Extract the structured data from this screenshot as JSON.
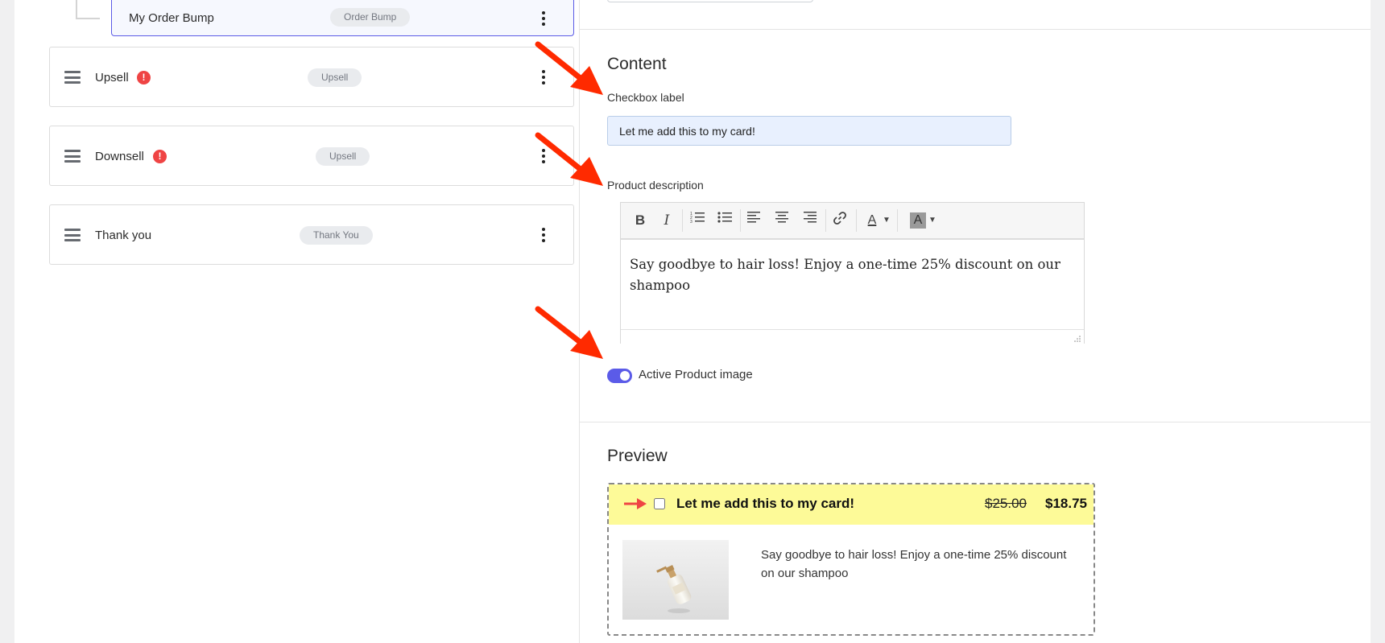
{
  "funnel_steps": {
    "sub_step": {
      "name": "My Order Bump",
      "badge": "Order Bump"
    },
    "steps": [
      {
        "name": "Upsell",
        "badge": "Upsell",
        "has_alert": true
      },
      {
        "name": "Downsell",
        "badge": "Upsell",
        "has_alert": true
      },
      {
        "name": "Thank you",
        "badge": "Thank You",
        "has_alert": false
      }
    ],
    "alert_glyph": "!"
  },
  "content": {
    "title": "Content",
    "checkbox_label_label": "Checkbox label",
    "checkbox_label_value": "Let me add this to my card!",
    "product_description_label": "Product description",
    "product_description_value": "Say goodbye to hair loss! Enjoy a one-time 25% discount on our shampoo",
    "toolbar": {
      "bold": "B",
      "italic": "I",
      "ordered_list": "ordered-list-icon",
      "bullet_list": "bullet-list-icon",
      "align_left": "align-left-icon",
      "align_center": "align-center-icon",
      "align_right": "align-right-icon",
      "link": "link-icon",
      "text_color": "A",
      "bg_color": "A"
    },
    "toggle_label": "Active Product image",
    "toggle_on": true
  },
  "preview": {
    "title": "Preview",
    "checkbox_text": "Let me add this to my card!",
    "price_old": "$25.00",
    "price_new": "$18.75",
    "description": "Say goodbye to hair loss! Enjoy a one-time 25% discount on our shampoo",
    "product_image": "shampoo-bottle-image"
  },
  "colors": {
    "accent": "#5b5be8",
    "alert": "#ef4444",
    "annotation_arrow": "#ff2a00",
    "preview_header": "#fdfa98"
  }
}
